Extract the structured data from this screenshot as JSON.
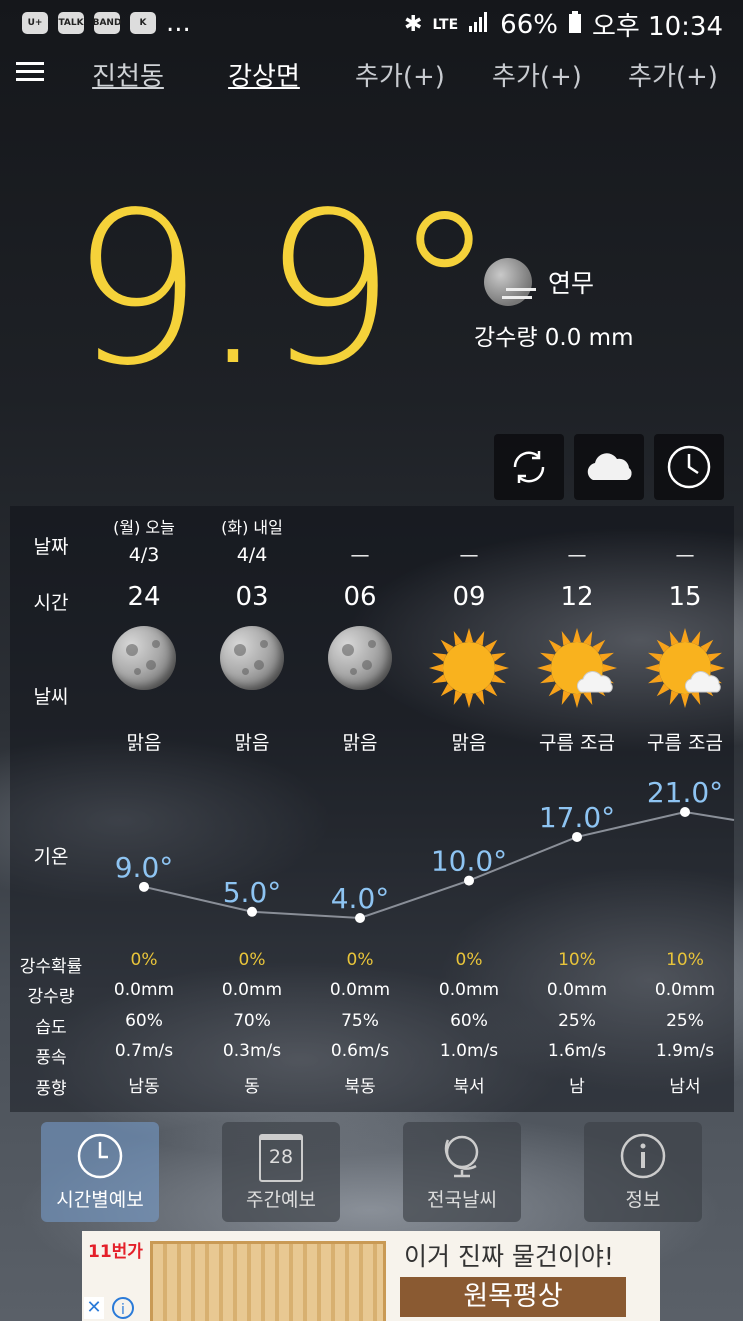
{
  "status_bar": {
    "ellipsis": "...",
    "network": "LTE",
    "battery": "66%",
    "time": "오후 10:34",
    "left_icons": [
      "U+ icon",
      "TALK",
      "BAND",
      "K"
    ]
  },
  "nav": {
    "tabs": [
      {
        "label": "진천동",
        "active": false
      },
      {
        "label": "강상면",
        "active": true
      },
      {
        "label": "추가(+)",
        "active": false
      },
      {
        "label": "추가(+)",
        "active": false
      },
      {
        "label": "추가(+)",
        "active": false
      }
    ]
  },
  "current": {
    "temperature": "9.9°",
    "condition": "연무",
    "precip": "강수량 0.0 mm"
  },
  "forecast": {
    "labels": {
      "date": "날짜",
      "time": "시간",
      "weather": "날씨",
      "temp": "기온",
      "prob": "강수확률",
      "amount": "강수량",
      "humidity": "습도",
      "wind_speed": "풍속",
      "wind_dir": "풍향"
    },
    "columns": [
      {
        "day": "(월) 오늘",
        "date": "4/3",
        "time": "24",
        "icon": "moon",
        "desc": "맑음",
        "temp": "9.0°",
        "prob": "0%",
        "amount": "0.0mm",
        "humidity": "60%",
        "wind_speed": "0.7m/s",
        "wind_dir": "남동"
      },
      {
        "day": "(화) 내일",
        "date": "4/4",
        "time": "03",
        "icon": "moon",
        "desc": "맑음",
        "temp": "5.0°",
        "prob": "0%",
        "amount": "0.0mm",
        "humidity": "70%",
        "wind_speed": "0.3m/s",
        "wind_dir": "동"
      },
      {
        "day": "",
        "date": "—",
        "time": "06",
        "icon": "moon",
        "desc": "맑음",
        "temp": "4.0°",
        "prob": "0%",
        "amount": "0.0mm",
        "humidity": "75%",
        "wind_speed": "0.6m/s",
        "wind_dir": "북동"
      },
      {
        "day": "",
        "date": "—",
        "time": "09",
        "icon": "sun",
        "desc": "맑음",
        "temp": "10.0°",
        "prob": "0%",
        "amount": "0.0mm",
        "humidity": "60%",
        "wind_speed": "1.0m/s",
        "wind_dir": "북서"
      },
      {
        "day": "",
        "date": "—",
        "time": "12",
        "icon": "sun-cloud",
        "desc": "구름 조금",
        "temp": "17.0°",
        "prob": "10%",
        "amount": "0.0mm",
        "humidity": "25%",
        "wind_speed": "1.6m/s",
        "wind_dir": "남"
      },
      {
        "day": "",
        "date": "—",
        "time": "15",
        "icon": "sun-cloud",
        "desc": "구름 조금",
        "temp": "21.0°",
        "prob": "10%",
        "amount": "0.0mm",
        "humidity": "25%",
        "wind_speed": "1.9m/s",
        "wind_dir": "남서"
      }
    ],
    "temp_values": [
      9.0,
      5.0,
      4.0,
      10.0,
      17.0,
      21.0
    ]
  },
  "bottom_nav": [
    {
      "label": "시간별예보",
      "icon": "clock-icon",
      "active": true
    },
    {
      "label": "주간예보",
      "icon": "calendar-icon",
      "active": false,
      "calendar_day": "28"
    },
    {
      "label": "전국날씨",
      "icon": "globe-icon",
      "active": false
    },
    {
      "label": "정보",
      "icon": "info-icon",
      "active": false
    }
  ],
  "ad": {
    "brand": "11번가",
    "headline": "이거 진짜 물건이야!",
    "product": "원목평상"
  },
  "colors": {
    "temp_yellow": "#f5d23a",
    "prob_yellow": "#e8c43a",
    "chart_blue": "#8ec4f2"
  }
}
